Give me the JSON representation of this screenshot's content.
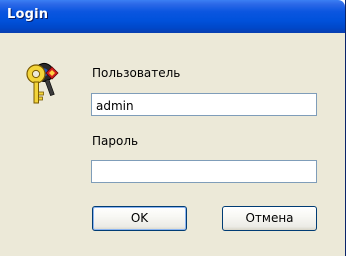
{
  "window": {
    "title": "Login"
  },
  "form": {
    "icon": "keys-icon",
    "username_label": "Пользователь",
    "username_value": "admin",
    "password_label": "Пароль",
    "password_value": ""
  },
  "buttons": {
    "ok_label": "OK",
    "cancel_label": "Отмена"
  },
  "colors": {
    "titlebar": "#0152dc",
    "dialog_background": "#ece9d8",
    "input_border": "#7f9db9",
    "button_border": "#003c74"
  }
}
